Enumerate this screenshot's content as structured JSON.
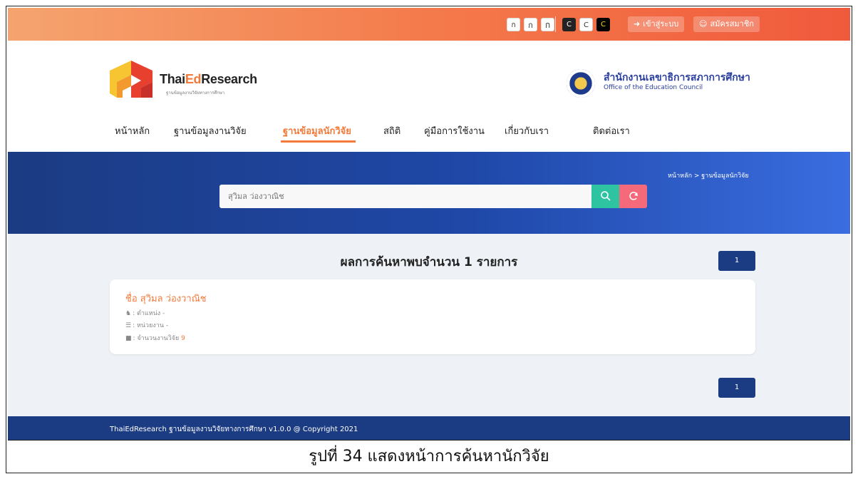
{
  "topbar": {
    "font_sizes": [
      "ก",
      "ก",
      "ก"
    ],
    "contrast": [
      "C",
      "C",
      "C"
    ],
    "login_label": "เข้าสู่ระบบ",
    "register_label": "สมัครสมาชิก"
  },
  "header": {
    "brand_prefix": "Thai",
    "brand_highlight": "Ed",
    "brand_suffix": "Research",
    "brand_subtitle": "ฐานข้อมูลงานวิจัยทางการศึกษา",
    "org_name_th": "สำนักงานเลขาธิการสภาการศึกษา",
    "org_name_en": "Office of the Education Council"
  },
  "nav": {
    "items": [
      {
        "label": "หน้าหลัก"
      },
      {
        "label": "ฐานข้อมูลงานวิจัย"
      },
      {
        "label": "ฐานข้อมูลนักวิจัย"
      },
      {
        "label": "สถิติ"
      },
      {
        "label": "คู่มือการใช้งาน"
      },
      {
        "label": "เกี่ยวกับเรา"
      },
      {
        "label": "ติดต่อเรา"
      }
    ],
    "active_index": 2
  },
  "search": {
    "placeholder": "สุวิมล ว่องวาณิช",
    "search_icon": "search-icon",
    "reset_icon": "refresh-icon"
  },
  "breadcrumb": "หน้าหลัก > ฐานข้อมูลนักวิจัย",
  "results": {
    "title": "ผลการค้นหาพบจำนวน 1 รายการ",
    "page_top": "1",
    "page_bottom": "1",
    "items": [
      {
        "name": "ชื่อ สุวิมล ว่องวาณิช",
        "position": ": ตำแหน่ง -",
        "agency": ": หน่วยงาน -",
        "count_label": ": จำนวนงานวิจัย",
        "count": "9"
      }
    ]
  },
  "footer": {
    "text": "ThaiEdResearch ฐานข้อมูลงานวิจัยทางการศึกษา v1.0.0 @ Copyright 2021"
  },
  "caption": "รูปที่ 34 แสดงหน้าการค้นหานักวิจัย",
  "colors": {
    "accent": "#f47a3a",
    "navy": "#1b3b82",
    "search_green": "#2ec4a2",
    "reset_pink": "#f46a7a"
  }
}
